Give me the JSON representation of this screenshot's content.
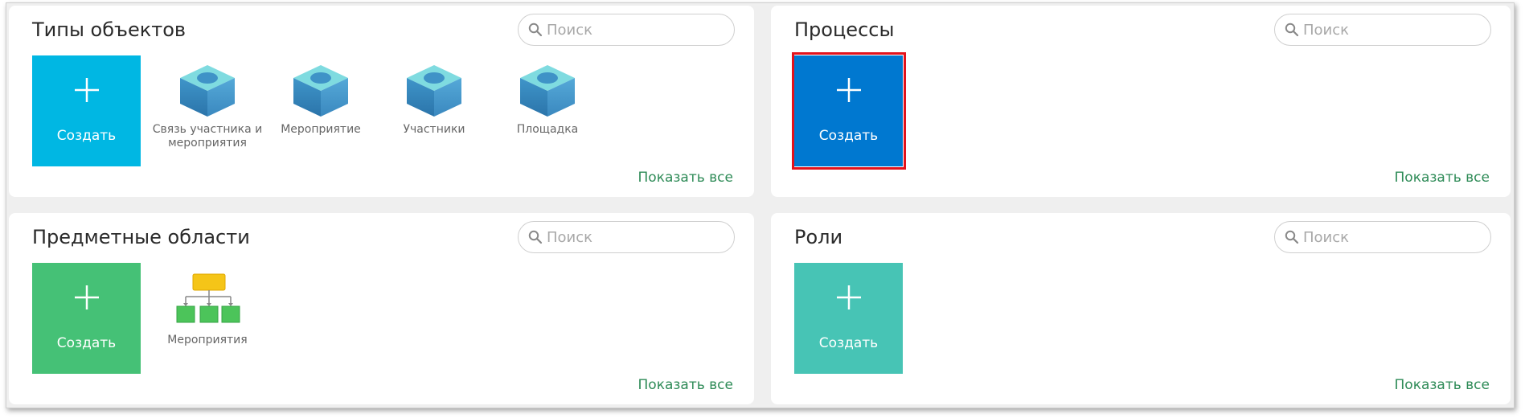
{
  "panels": {
    "object_types": {
      "title": "Типы объектов",
      "search_placeholder": "Поиск",
      "create_label": "Создать",
      "create_color": "#00b7e3",
      "items": [
        {
          "label": "Связь участника и мероприятия",
          "icon": "cube-icon"
        },
        {
          "label": "Мероприятие",
          "icon": "cube-icon"
        },
        {
          "label": "Участники",
          "icon": "cube-icon"
        },
        {
          "label": "Площадка",
          "icon": "cube-icon"
        }
      ],
      "show_all": "Показать все"
    },
    "processes": {
      "title": "Процессы",
      "search_placeholder": "Поиск",
      "create_label": "Создать",
      "create_color": "#0078d0",
      "create_selected": true,
      "show_all": "Показать все"
    },
    "subject_areas": {
      "title": "Предметные области",
      "search_placeholder": "Поиск",
      "create_label": "Создать",
      "create_color": "#45c176",
      "items": [
        {
          "label": "Мероприятия",
          "icon": "hierarchy-diagram-icon"
        }
      ],
      "show_all": "Показать все"
    },
    "roles": {
      "title": "Роли",
      "search_placeholder": "Поиск",
      "create_label": "Создать",
      "create_color": "#47c4b5",
      "show_all": "Показать все"
    }
  }
}
